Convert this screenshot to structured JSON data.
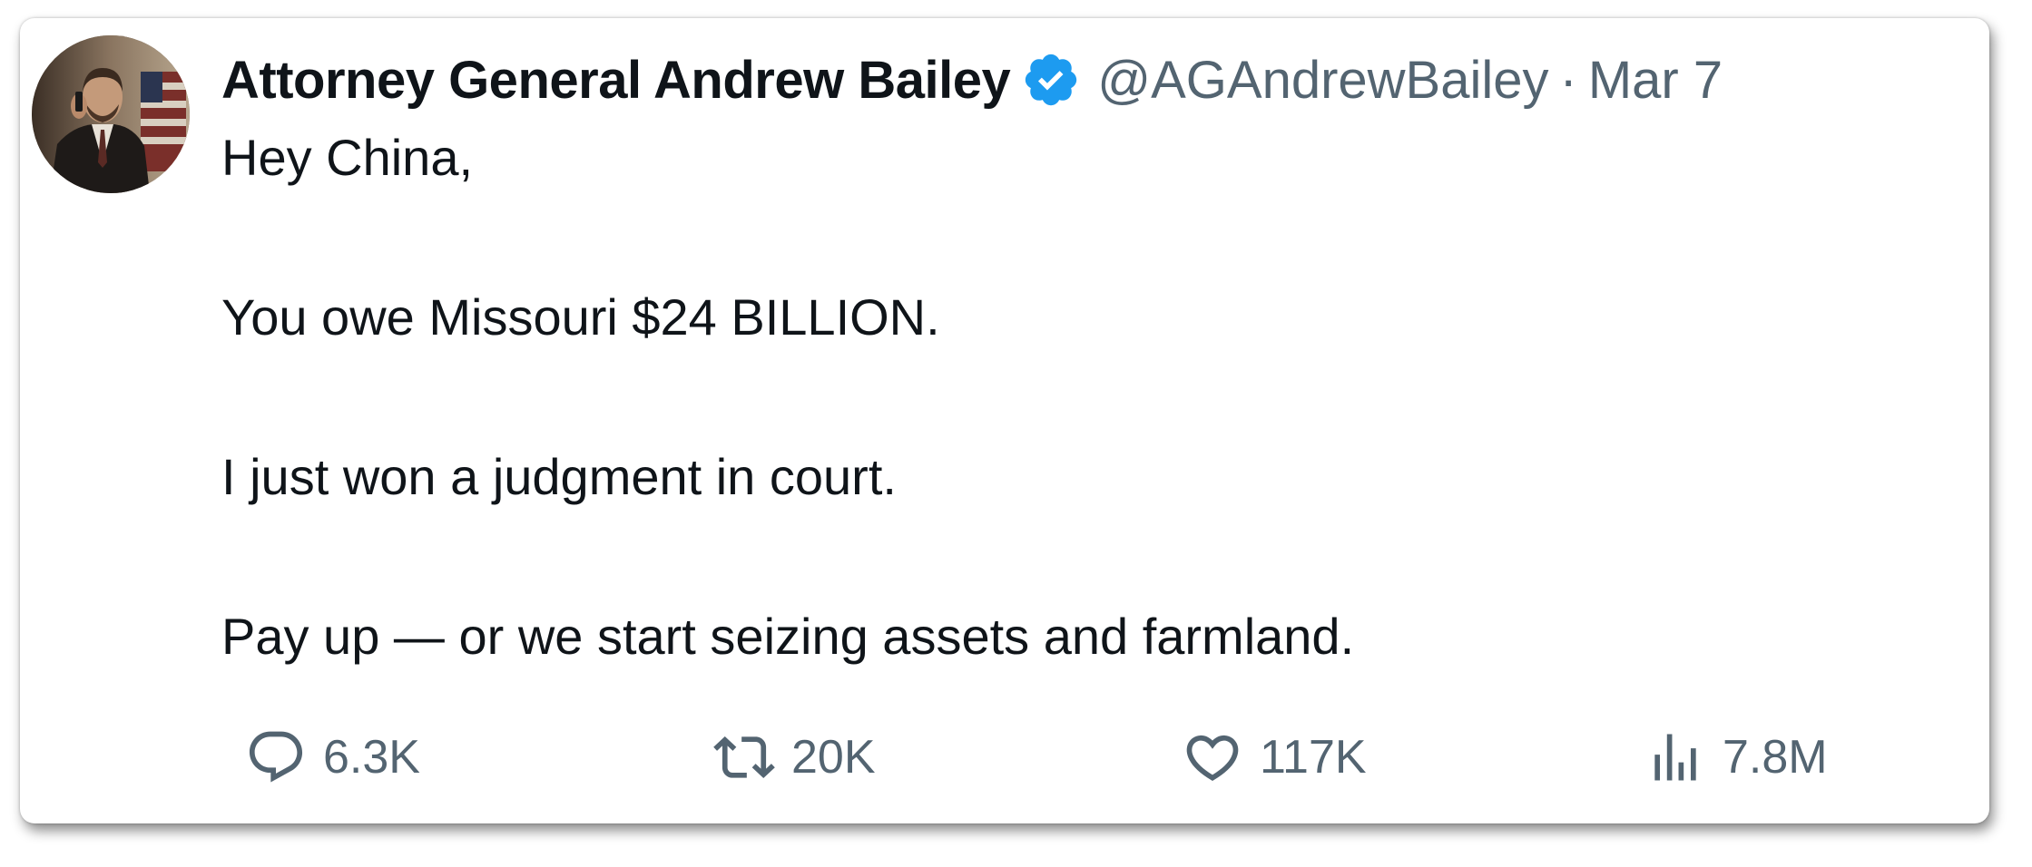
{
  "tweet": {
    "author": {
      "display_name": "Attorney General Andrew Bailey",
      "handle": "@AGAndrewBailey",
      "verified": true,
      "avatar_icon": "profile-photo"
    },
    "separator": "·",
    "date": "Mar 7",
    "text_lines": [
      "Hey China,",
      "You owe Missouri $24 BILLION.",
      "I just won a judgment in court.",
      "Pay up — or we start seizing assets and farmland."
    ],
    "actions": {
      "replies": "6.3K",
      "retweets": "20K",
      "likes": "117K",
      "views": "7.8M"
    }
  },
  "colors": {
    "verified_badge": "#1d9bf0",
    "text_primary": "#0f1419",
    "text_secondary": "#536471"
  },
  "icons": {
    "reply": "reply-icon",
    "retweet": "retweet-icon",
    "like": "heart-icon",
    "views": "views-icon"
  }
}
